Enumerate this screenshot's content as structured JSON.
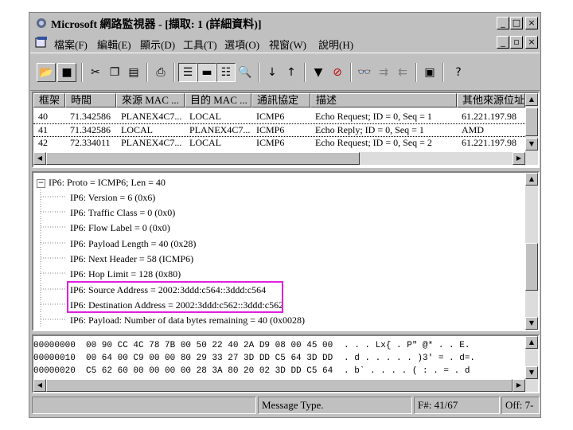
{
  "window": {
    "title": "Microsoft 網路監視器 - [擷取: 1 (詳細資料)]"
  },
  "menu": [
    "檔案(F)",
    "編輯(E)",
    "顯示(D)",
    "工具(T)",
    "選項(O)",
    "視窗(W)",
    "說明(H)"
  ],
  "frames": {
    "columns": [
      "框架",
      "時間",
      "來源 MAC ...",
      "目的 MAC ...",
      "通訊協定",
      "描述",
      "其他來源位址"
    ],
    "rows": [
      [
        "40",
        "71.342586",
        "PLANEX4C7...",
        "LOCAL",
        "ICMP6",
        "Echo Request; ID = 0, Seq = 1",
        "61.221.197.98"
      ],
      [
        "41",
        "71.342586",
        "LOCAL",
        "PLANEX4C7...",
        "ICMP6",
        "Echo Reply; ID = 0, Seq = 1",
        "AMD"
      ],
      [
        "42",
        "72.334011",
        "PLANEX4C7...",
        "LOCAL",
        "ICMP6",
        "Echo Request; ID = 0, Seq = 2",
        "61.221.197.98"
      ]
    ]
  },
  "details": {
    "root": "IP6: Proto = ICMP6; Len = 40",
    "items": [
      "IP6: Version = 6 (0x6)",
      "IP6: Traffic Class = 0 (0x0)",
      "IP6: Flow Label = 0 (0x0)",
      "IP6: Payload Length = 40 (0x28)",
      "IP6: Next Header = 58 (ICMP6)",
      "IP6: Hop Limit = 128 (0x80)",
      "IP6: Source Address = 2002:3ddd:c564::3ddd:c564",
      "IP6: Destination Address = 2002:3ddd:c562::3ddd:c562",
      "IP6: Payload: Number of data bytes remaining = 40 (0x0028)"
    ],
    "highlight_color": "#e020e0"
  },
  "hex": {
    "rows": [
      {
        "offset": "00000000",
        "bytes": "00 90 CC 4C 78 7B 00 50 22 40 2A D9 08 00 45 00",
        "ascii": ". . . Lx{ . P\" @* . . E."
      },
      {
        "offset": "00000010",
        "bytes": "00 64 00 C9 00 00 80 29 33 27 3D DD C5 64 3D DD",
        "ascii": ". d . . . . . )3' = . d=."
      },
      {
        "offset": "00000020",
        "bytes": "C5 62 60 00 00 00 00 28 3A 80 20 02 3D DD C5 64",
        "ascii": ". b` . . . . ( : . = . d"
      }
    ]
  },
  "status": {
    "message": "Message Type.",
    "frame": "F#: 41/67",
    "offset": "Off: 7-"
  }
}
